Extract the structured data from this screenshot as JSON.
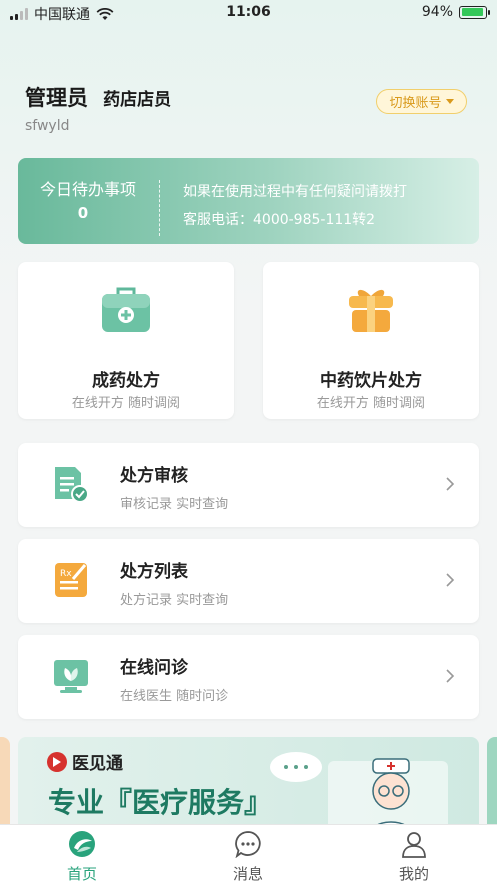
{
  "status_bar": {
    "carrier": "中国联通",
    "time": "11:06",
    "battery": "94%",
    "battery_level": 0.94
  },
  "user": {
    "name": "管理员",
    "role": "药店店员",
    "id": "sfwyld",
    "switch_label": "切换账号"
  },
  "todo": {
    "title": "今日待办事项",
    "count": "0",
    "notice_line1": "如果在使用过程中有任何疑问请拨打",
    "notice_line2": "客服电话：4000-985-111转2"
  },
  "cards": [
    {
      "title": "成药处方",
      "subtitle": "在线开方 随时调阅",
      "icon": "medical-kit-icon"
    },
    {
      "title": "中药饮片处方",
      "subtitle": "在线开方 随时调阅",
      "icon": "gift-box-icon"
    }
  ],
  "list": [
    {
      "title": "处方审核",
      "subtitle": "审核记录 实时查询",
      "icon": "document-check-icon"
    },
    {
      "title": "处方列表",
      "subtitle": "处方记录 实时查询",
      "icon": "prescription-icon"
    },
    {
      "title": "在线问诊",
      "subtitle": "在线医生 随时问诊",
      "icon": "monitor-plant-icon"
    }
  ],
  "banner": {
    "logo_text": "医见通",
    "slogan": "专业『医疗服务』"
  },
  "tabbar": [
    {
      "label": "首页",
      "icon": "home-logo-icon",
      "active": true
    },
    {
      "label": "消息",
      "icon": "chat-bubble-icon",
      "active": false
    },
    {
      "label": "我的",
      "icon": "person-icon",
      "active": false
    }
  ],
  "colors": {
    "accent": "#29a37c",
    "todo_gradient_start": "#69b99b",
    "switch_text": "#d99a1c"
  }
}
